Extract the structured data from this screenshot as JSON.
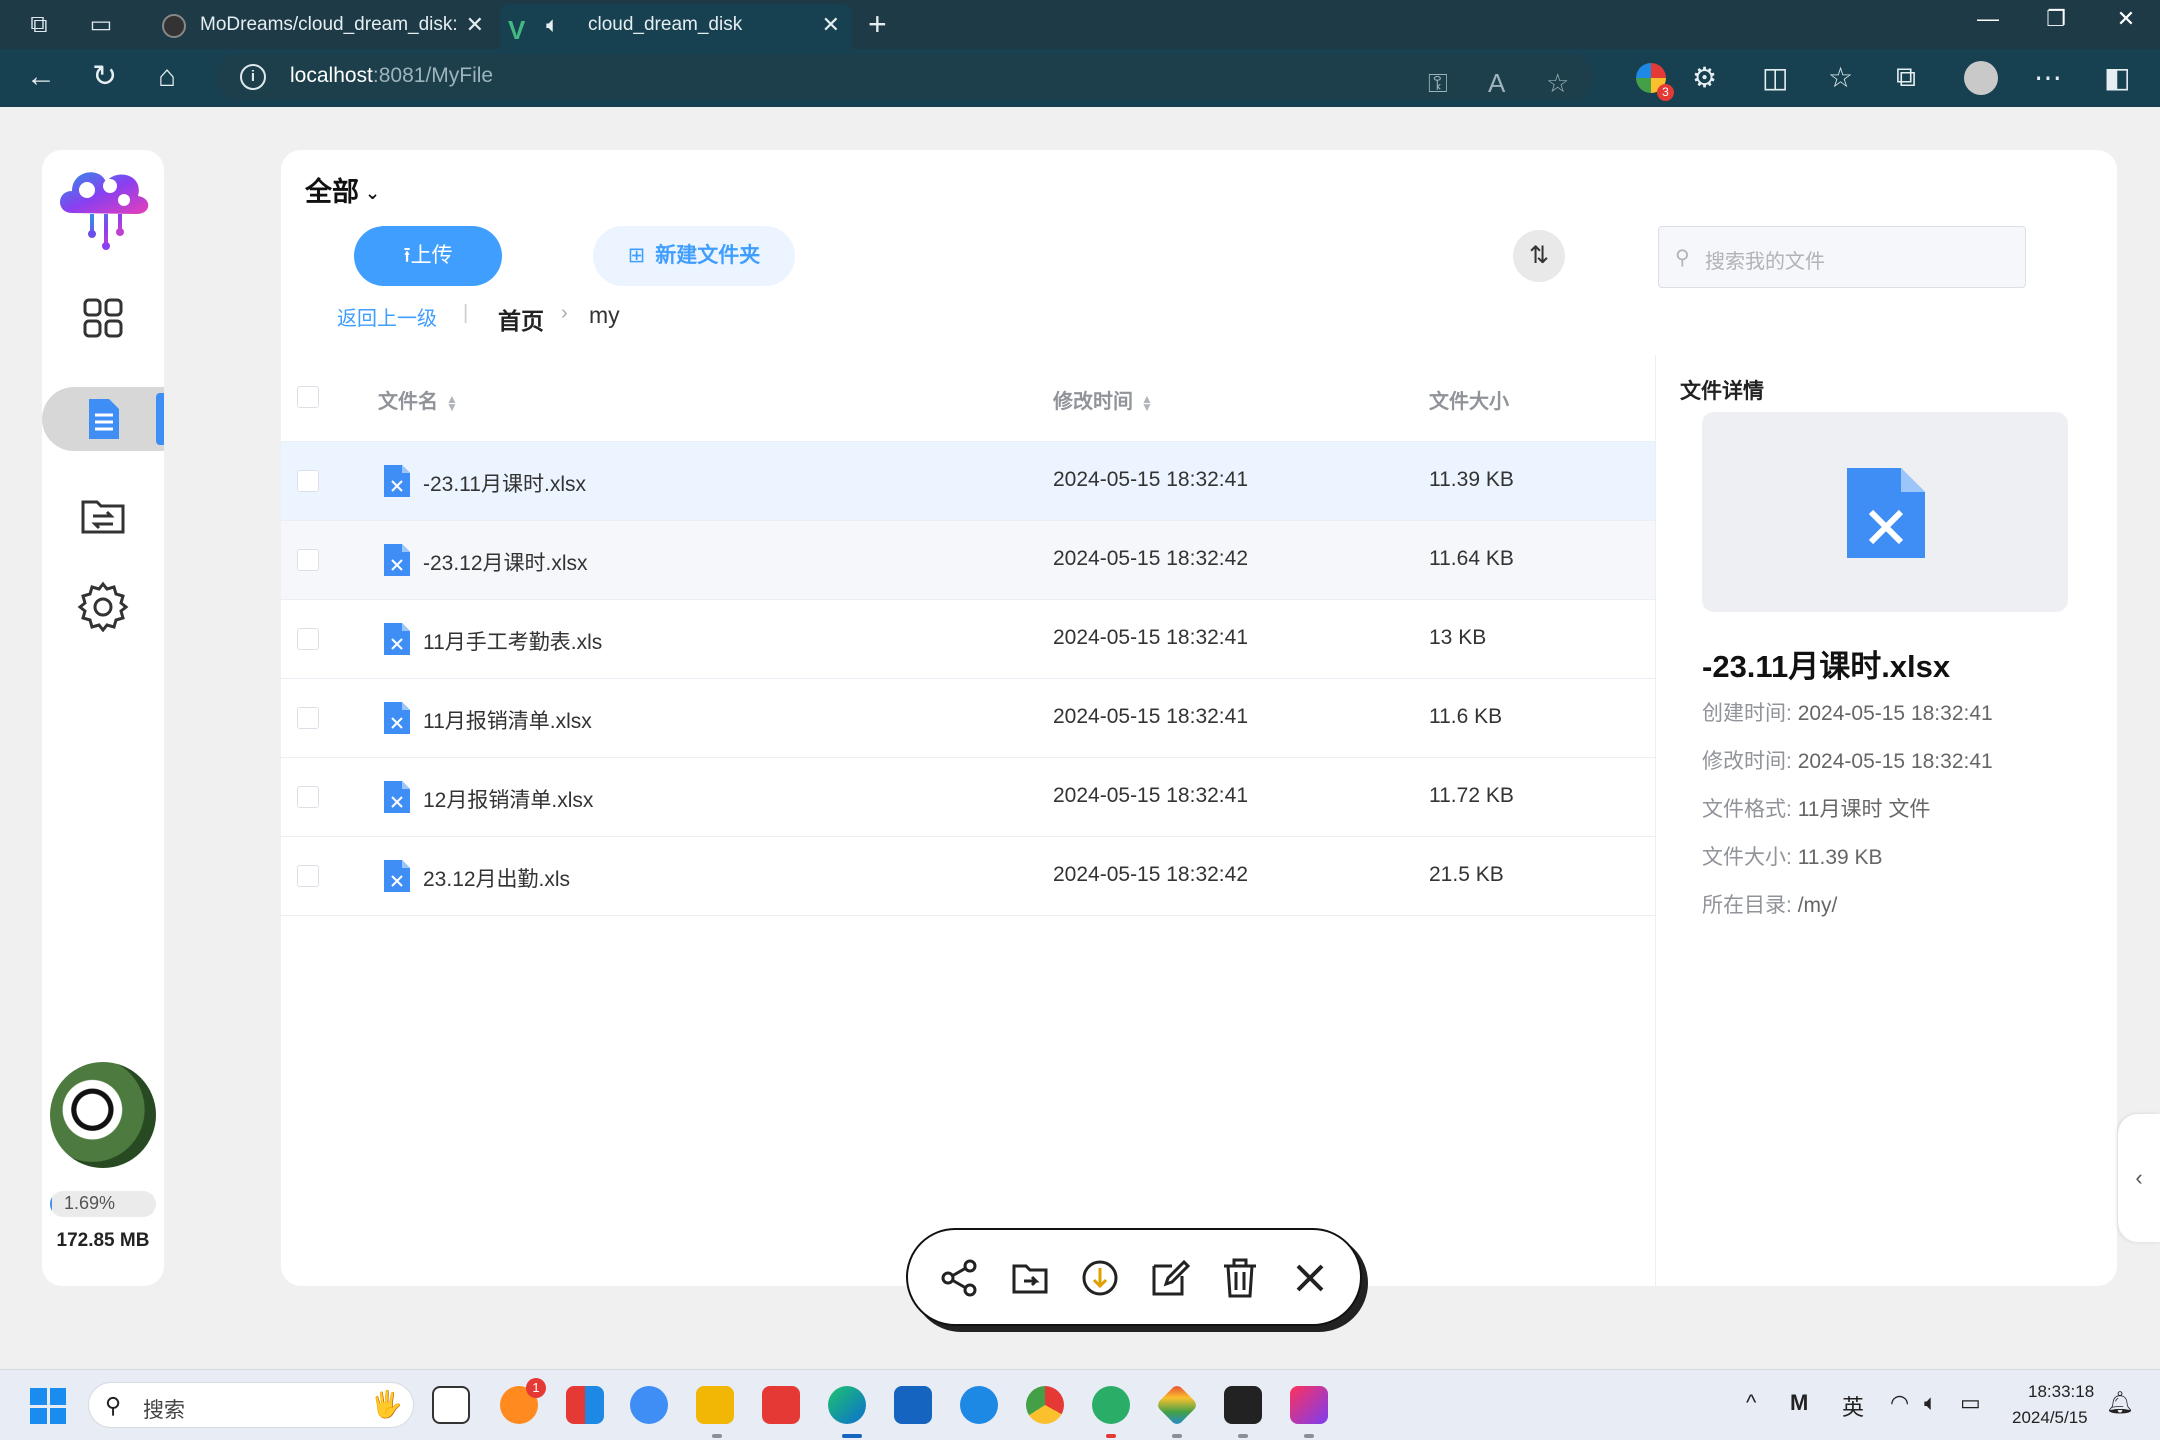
{
  "browser": {
    "tabs": [
      {
        "title": "MoDreams/cloud_dream_disk: —"
      },
      {
        "title": "cloud_dream_disk"
      }
    ],
    "url_host": "localhost",
    "url_rest": ":8081/MyFile",
    "extension_badge": "3"
  },
  "sidebar": {
    "usage_percent": "1.69%",
    "usage_fraction": 0.0169,
    "storage_used": "172.85 MB"
  },
  "toolbar": {
    "scope_label": "全部",
    "upload_label": "上传",
    "new_folder_label": "新建文件夹",
    "search_placeholder": "搜索我的文件"
  },
  "breadcrumb": {
    "back_label": "返回上一级",
    "home_label": "首页",
    "current": "my"
  },
  "table": {
    "columns": {
      "name": "文件名",
      "modified": "修改时间",
      "size": "文件大小"
    },
    "rows": [
      {
        "name": "-23.11月课时.xlsx",
        "modified": "2024-05-15 18:32:41",
        "size": "11.39 KB"
      },
      {
        "name": "-23.12月课时.xlsx",
        "modified": "2024-05-15 18:32:42",
        "size": "11.64 KB"
      },
      {
        "name": "11月手工考勤表.xls",
        "modified": "2024-05-15 18:32:41",
        "size": "13 KB"
      },
      {
        "name": "11月报销清单.xlsx",
        "modified": "2024-05-15 18:32:41",
        "size": "11.6 KB"
      },
      {
        "name": "12月报销清单.xlsx",
        "modified": "2024-05-15 18:32:41",
        "size": "11.72 KB"
      },
      {
        "name": "23.12月出勤.xls",
        "modified": "2024-05-15 18:32:42",
        "size": "21.5 KB"
      }
    ]
  },
  "detail": {
    "title": "文件详情",
    "file_name": "-23.11月课时.xlsx",
    "created_label": "创建时间:",
    "created_value": "2024-05-15 18:32:41",
    "modified_label": "修改时间:",
    "modified_value": "2024-05-15 18:32:41",
    "format_label": "文件格式:",
    "format_value": "11月课时 文件",
    "size_label": "文件大小:",
    "size_value": "11.39 KB",
    "dir_label": "所在目录:",
    "dir_value": "/my/"
  },
  "taskbar": {
    "search_placeholder": "搜索",
    "ime_label": "英",
    "time": "18:33:18",
    "date": "2024/5/15",
    "notification_badge": "1"
  },
  "colors": {
    "accent": "#409eff",
    "chrome": "#174150",
    "selected_row": "#ecf5ff"
  }
}
